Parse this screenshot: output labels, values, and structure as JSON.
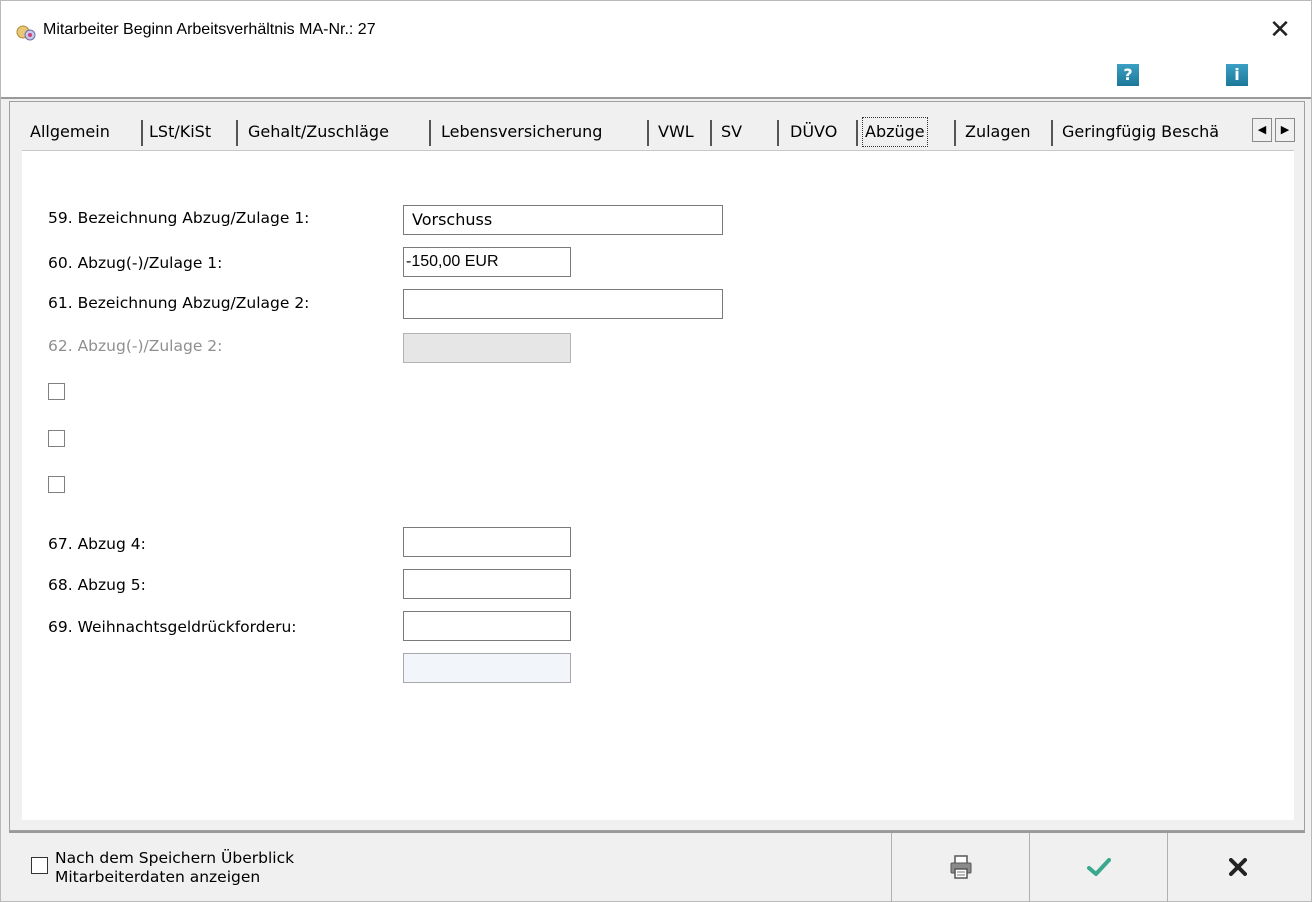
{
  "window": {
    "title": "Mitarbeiter Beginn Arbeitsverhältnis MA-Nr.: 27",
    "close_glyph": "✕",
    "help_glyph": "?",
    "info_glyph": "i"
  },
  "tabs": [
    {
      "label": "Allgemein",
      "active": false
    },
    {
      "label": "LSt/KiSt",
      "active": false
    },
    {
      "label": "Gehalt/Zuschläge",
      "active": false
    },
    {
      "label": "Lebensversicherung",
      "active": false
    },
    {
      "label": "VWL",
      "active": false
    },
    {
      "label": "SV",
      "active": false
    },
    {
      "label": "DÜVO",
      "active": false
    },
    {
      "label": "Abzüge",
      "active": true
    },
    {
      "label": "Zulagen",
      "active": false
    },
    {
      "label": "Geringfügig Beschä",
      "active": false
    }
  ],
  "tab_scroll": {
    "left": "◀",
    "right": "▶"
  },
  "fields": {
    "f59": {
      "label": "59. Bezeichnung Abzug/Zulage 1:",
      "value": "Vorschuss"
    },
    "f60": {
      "label": "60. Abzug(-)/Zulage 1:",
      "value": "-150,00 EUR"
    },
    "f61": {
      "label": "61. Bezeichnung Abzug/Zulage 2:",
      "value": ""
    },
    "f62": {
      "label": "62. Abzug(-)/Zulage 2:",
      "value": ""
    },
    "f67": {
      "label": "67. Abzug 4:",
      "value": ""
    },
    "f68": {
      "label": "68. Abzug 5:",
      "value": ""
    },
    "f69": {
      "label": "69. Weihnachtsgeldrückforderu:",
      "value": ""
    },
    "f70": {
      "value": ""
    }
  },
  "footer": {
    "show_overview_label": "Nach dem Speichern Überblick Mitarbeiterdaten anzeigen",
    "print_icon": "print-icon",
    "ok_icon": "checkmark-icon",
    "cancel_icon": "close-icon",
    "ok_color": "#3aa88c",
    "cancel_color": "#222222"
  }
}
